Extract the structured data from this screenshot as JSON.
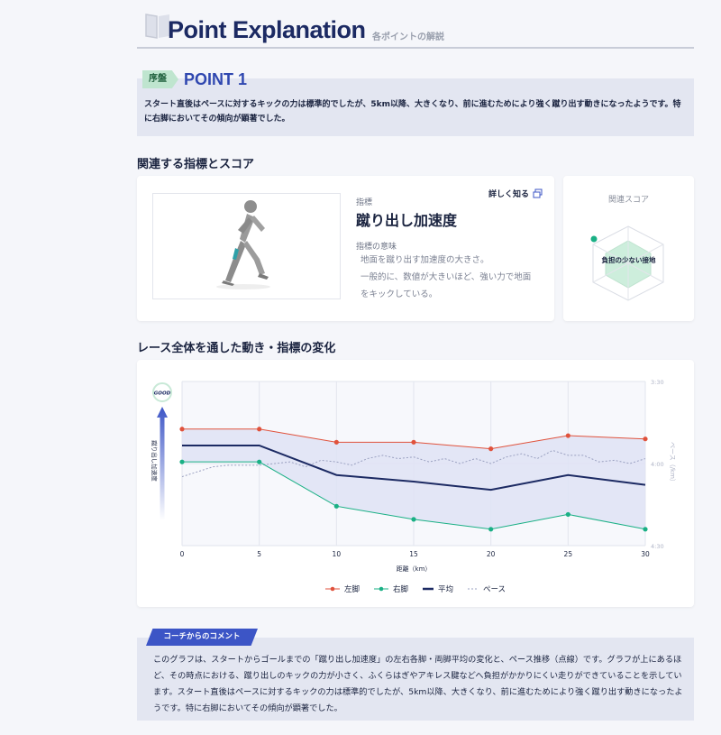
{
  "header": {
    "title": "Point Explanation",
    "subtitle": "各ポイントの解説"
  },
  "point": {
    "tag": "序盤",
    "title": "POINT 1",
    "text": "スタート直後はペースに対するキックの力は標準的でしたが、5km以降、大きくなり、前に進むためにより強く蹴り出す動きになったようです。特に右脚においてその傾向が顕著でした。"
  },
  "indicators_section": {
    "title": "関連する指標とスコア",
    "indicator_label": "指標",
    "indicator_name": "蹴り出し加速度",
    "more_link": "詳しく知る",
    "meaning_label": "指標の意味",
    "meaning_lines": [
      "地面を蹴り出す加速度の大きさ。",
      "一般的に、数値が大きいほど、強い力で地面",
      "をキックしている。"
    ],
    "score_title": "関連スコア",
    "score_label": "負担の少ない接地"
  },
  "change_section": {
    "title": "レース全体を通した動き・指標の変化"
  },
  "chart_data": {
    "type": "line",
    "x": [
      0,
      5,
      10,
      15,
      20,
      25,
      30
    ],
    "xlabel": "距離（km）",
    "ylabel_left": "蹴り出し加速度",
    "ylabel_right": "ペース（/km）",
    "good_label": "GOOD",
    "y2_ticks": [
      "3:30",
      "4:00",
      "4:30"
    ],
    "xlim": [
      0,
      30
    ],
    "grid": true,
    "legend_position": "bottom",
    "series": [
      {
        "name": "左脚",
        "color": "#e0523c",
        "marker": "dot",
        "values": [
          0.71,
          0.71,
          0.63,
          0.63,
          0.59,
          0.67,
          0.65
        ]
      },
      {
        "name": "右脚",
        "color": "#1ab085",
        "marker": "dot",
        "values": [
          0.51,
          0.51,
          0.24,
          0.16,
          0.1,
          0.19,
          0.1
        ]
      },
      {
        "name": "平均",
        "color": "#1c2a63",
        "marker": "none",
        "values": [
          0.61,
          0.61,
          0.43,
          0.39,
          0.34,
          0.43,
          0.37
        ]
      }
    ],
    "pace": {
      "name": "ペース",
      "color": "#9aa0c0",
      "x": [
        0,
        1,
        2,
        3,
        5,
        6,
        7,
        8,
        9,
        10,
        11,
        12,
        13,
        14,
        15,
        16,
        17,
        18,
        19,
        20,
        21,
        22,
        23,
        24,
        25,
        26,
        27,
        28,
        29,
        30
      ],
      "values": [
        4.08,
        4.05,
        4.02,
        4.01,
        4.01,
        4.0,
        3.99,
        4.02,
        3.98,
        3.99,
        4.01,
        3.97,
        3.95,
        3.97,
        3.96,
        3.99,
        3.97,
        4.0,
        3.97,
        4.0,
        3.96,
        3.94,
        3.97,
        3.92,
        3.95,
        3.95,
        3.99,
        3.98,
        4.0,
        3.97
      ]
    }
  },
  "legend": [
    "左脚",
    "右脚",
    "平均",
    "ペース"
  ],
  "coach": {
    "tag": "コーチからのコメント",
    "text": "このグラフは、スタートからゴールまでの「蹴り出し加速度」の左右各脚・両脚平均の変化と、ペース推移（点線）です。グラフが上にあるほど、その時点における、蹴り出しのキックの力が小さく、ふくらはぎやアキレス腱などへ負担がかかりにくい走りができていることを示しています。スタート直後はペースに対するキックの力は標準的でしたが、5km以降、大きくなり、前に進むためにより強く蹴り出す動きになったようです。特に右脚においてその傾向が顕著でした。"
  },
  "colors": {
    "brand": "#1c2a63",
    "accent": "#3c55c6",
    "left_leg": "#e0523c",
    "right_leg": "#1ab085",
    "band": "#dfe3f4"
  }
}
